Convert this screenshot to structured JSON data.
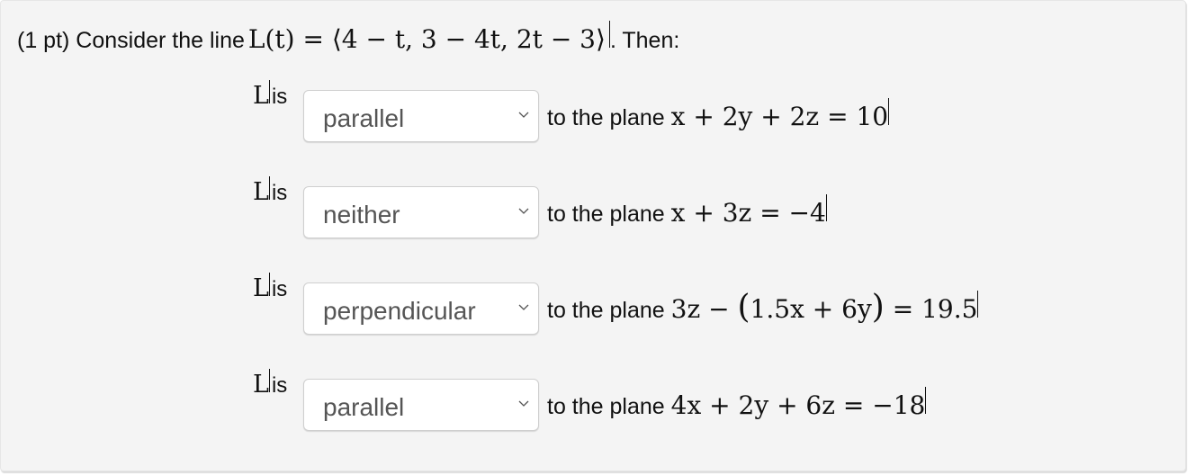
{
  "question": {
    "points": "(1 pt) Consider the line",
    "line_expr": "L(t) = ⟨4 − t, 3 − 4t, 2t − 3⟩",
    "suffix": ". Then:"
  },
  "rows": [
    {
      "subject": "L",
      "verb": "is",
      "selected": "parallel",
      "to_text": "to the plane",
      "plane": "x + 2y + 2z = 10"
    },
    {
      "subject": "L",
      "verb": "is",
      "selected": "neither",
      "to_text": "to the plane",
      "plane": "x + 3z = −4"
    },
    {
      "subject": "L",
      "verb": "is",
      "selected": "perpendicular",
      "to_text": "to the plane",
      "plane_pre": "3z − ",
      "plane_paren_open": "(",
      "plane_inner": "1.5x + 6y",
      "plane_paren_close": ")",
      "plane_post": " = 19.5"
    },
    {
      "subject": "L",
      "verb": "is",
      "selected": "parallel",
      "to_text": "to the plane",
      "plane": "4x + 2y + 6z = −18"
    }
  ],
  "icons": {
    "dropdown": "chevron-down-icon"
  }
}
